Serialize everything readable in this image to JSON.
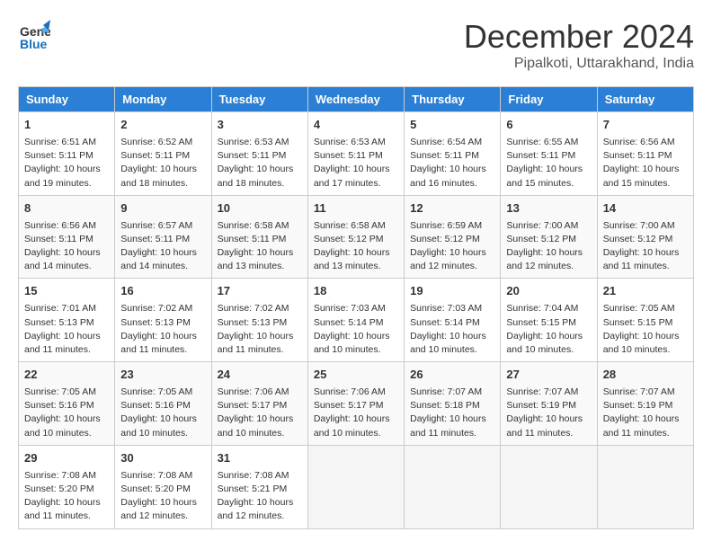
{
  "logo": {
    "general": "General",
    "blue": "Blue"
  },
  "title": "December 2024",
  "location": "Pipalkoti, Uttarakhand, India",
  "days_of_week": [
    "Sunday",
    "Monday",
    "Tuesday",
    "Wednesday",
    "Thursday",
    "Friday",
    "Saturday"
  ],
  "weeks": [
    [
      {
        "day": "1",
        "sunrise": "Sunrise: 6:51 AM",
        "sunset": "Sunset: 5:11 PM",
        "daylight": "Daylight: 10 hours and 19 minutes."
      },
      {
        "day": "2",
        "sunrise": "Sunrise: 6:52 AM",
        "sunset": "Sunset: 5:11 PM",
        "daylight": "Daylight: 10 hours and 18 minutes."
      },
      {
        "day": "3",
        "sunrise": "Sunrise: 6:53 AM",
        "sunset": "Sunset: 5:11 PM",
        "daylight": "Daylight: 10 hours and 18 minutes."
      },
      {
        "day": "4",
        "sunrise": "Sunrise: 6:53 AM",
        "sunset": "Sunset: 5:11 PM",
        "daylight": "Daylight: 10 hours and 17 minutes."
      },
      {
        "day": "5",
        "sunrise": "Sunrise: 6:54 AM",
        "sunset": "Sunset: 5:11 PM",
        "daylight": "Daylight: 10 hours and 16 minutes."
      },
      {
        "day": "6",
        "sunrise": "Sunrise: 6:55 AM",
        "sunset": "Sunset: 5:11 PM",
        "daylight": "Daylight: 10 hours and 15 minutes."
      },
      {
        "day": "7",
        "sunrise": "Sunrise: 6:56 AM",
        "sunset": "Sunset: 5:11 PM",
        "daylight": "Daylight: 10 hours and 15 minutes."
      }
    ],
    [
      {
        "day": "8",
        "sunrise": "Sunrise: 6:56 AM",
        "sunset": "Sunset: 5:11 PM",
        "daylight": "Daylight: 10 hours and 14 minutes."
      },
      {
        "day": "9",
        "sunrise": "Sunrise: 6:57 AM",
        "sunset": "Sunset: 5:11 PM",
        "daylight": "Daylight: 10 hours and 14 minutes."
      },
      {
        "day": "10",
        "sunrise": "Sunrise: 6:58 AM",
        "sunset": "Sunset: 5:11 PM",
        "daylight": "Daylight: 10 hours and 13 minutes."
      },
      {
        "day": "11",
        "sunrise": "Sunrise: 6:58 AM",
        "sunset": "Sunset: 5:12 PM",
        "daylight": "Daylight: 10 hours and 13 minutes."
      },
      {
        "day": "12",
        "sunrise": "Sunrise: 6:59 AM",
        "sunset": "Sunset: 5:12 PM",
        "daylight": "Daylight: 10 hours and 12 minutes."
      },
      {
        "day": "13",
        "sunrise": "Sunrise: 7:00 AM",
        "sunset": "Sunset: 5:12 PM",
        "daylight": "Daylight: 10 hours and 12 minutes."
      },
      {
        "day": "14",
        "sunrise": "Sunrise: 7:00 AM",
        "sunset": "Sunset: 5:12 PM",
        "daylight": "Daylight: 10 hours and 11 minutes."
      }
    ],
    [
      {
        "day": "15",
        "sunrise": "Sunrise: 7:01 AM",
        "sunset": "Sunset: 5:13 PM",
        "daylight": "Daylight: 10 hours and 11 minutes."
      },
      {
        "day": "16",
        "sunrise": "Sunrise: 7:02 AM",
        "sunset": "Sunset: 5:13 PM",
        "daylight": "Daylight: 10 hours and 11 minutes."
      },
      {
        "day": "17",
        "sunrise": "Sunrise: 7:02 AM",
        "sunset": "Sunset: 5:13 PM",
        "daylight": "Daylight: 10 hours and 11 minutes."
      },
      {
        "day": "18",
        "sunrise": "Sunrise: 7:03 AM",
        "sunset": "Sunset: 5:14 PM",
        "daylight": "Daylight: 10 hours and 10 minutes."
      },
      {
        "day": "19",
        "sunrise": "Sunrise: 7:03 AM",
        "sunset": "Sunset: 5:14 PM",
        "daylight": "Daylight: 10 hours and 10 minutes."
      },
      {
        "day": "20",
        "sunrise": "Sunrise: 7:04 AM",
        "sunset": "Sunset: 5:15 PM",
        "daylight": "Daylight: 10 hours and 10 minutes."
      },
      {
        "day": "21",
        "sunrise": "Sunrise: 7:05 AM",
        "sunset": "Sunset: 5:15 PM",
        "daylight": "Daylight: 10 hours and 10 minutes."
      }
    ],
    [
      {
        "day": "22",
        "sunrise": "Sunrise: 7:05 AM",
        "sunset": "Sunset: 5:16 PM",
        "daylight": "Daylight: 10 hours and 10 minutes."
      },
      {
        "day": "23",
        "sunrise": "Sunrise: 7:05 AM",
        "sunset": "Sunset: 5:16 PM",
        "daylight": "Daylight: 10 hours and 10 minutes."
      },
      {
        "day": "24",
        "sunrise": "Sunrise: 7:06 AM",
        "sunset": "Sunset: 5:17 PM",
        "daylight": "Daylight: 10 hours and 10 minutes."
      },
      {
        "day": "25",
        "sunrise": "Sunrise: 7:06 AM",
        "sunset": "Sunset: 5:17 PM",
        "daylight": "Daylight: 10 hours and 10 minutes."
      },
      {
        "day": "26",
        "sunrise": "Sunrise: 7:07 AM",
        "sunset": "Sunset: 5:18 PM",
        "daylight": "Daylight: 10 hours and 11 minutes."
      },
      {
        "day": "27",
        "sunrise": "Sunrise: 7:07 AM",
        "sunset": "Sunset: 5:19 PM",
        "daylight": "Daylight: 10 hours and 11 minutes."
      },
      {
        "day": "28",
        "sunrise": "Sunrise: 7:07 AM",
        "sunset": "Sunset: 5:19 PM",
        "daylight": "Daylight: 10 hours and 11 minutes."
      }
    ],
    [
      {
        "day": "29",
        "sunrise": "Sunrise: 7:08 AM",
        "sunset": "Sunset: 5:20 PM",
        "daylight": "Daylight: 10 hours and 11 minutes."
      },
      {
        "day": "30",
        "sunrise": "Sunrise: 7:08 AM",
        "sunset": "Sunset: 5:20 PM",
        "daylight": "Daylight: 10 hours and 12 minutes."
      },
      {
        "day": "31",
        "sunrise": "Sunrise: 7:08 AM",
        "sunset": "Sunset: 5:21 PM",
        "daylight": "Daylight: 10 hours and 12 minutes."
      },
      null,
      null,
      null,
      null
    ]
  ]
}
